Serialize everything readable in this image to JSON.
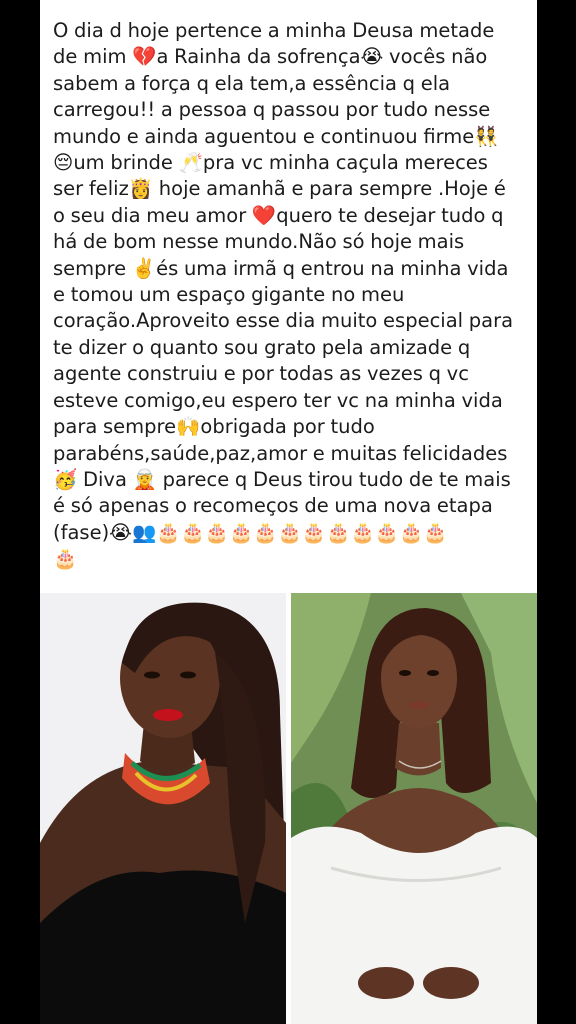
{
  "post": {
    "text": "O dia d hoje pertence a minha Deusa metade\nde mim 💔a Rainha da sofrença😭 vocês não\nsabem a força q ela tem,a essência q ela\ncarregou!! a pessoa q passou por tudo nesse\nmundo e ainda aguentou e continuou firme👯\n😔um brinde 🥂pra vc minha caçula mereces\nser feliz👸 hoje amanhã e para sempre .Hoje é\no seu dia meu amor ❤️quero te desejar tudo q\nhá de bom nesse mundo.Não só hoje mais\nsempre ✌️és uma irmã q entrou na minha vida\ne tomou um espaço gigante no meu\ncoração.Aproveito esse dia muito especial para\nte dizer o quanto sou grato pela amizade q\nagente construiu e por todas as vezes q vc\nesteve comigo,eu espero ter vc na minha vida\npara sempre🙌obrigada por tudo\nparabéns,saúde,paz,amor e muitas felicidades\n🥳 Diva 🧝 parece q Deus tirou tudo de te mais\né só apenas o recomeços de uma nova etapa\n(fase)😭👥🎂🎂🎂🎂🎂🎂🎂🎂🎂🎂🎂🎂\n🎂"
  },
  "photos": [
    {
      "name": "photo-left",
      "subject": "woman-red-lips-black-top",
      "background": "#f1f1f3"
    },
    {
      "name": "photo-right",
      "subject": "woman-white-offshoulder-dress",
      "background": "#6f8f55"
    }
  ],
  "colors": {
    "page_bg": "#000000",
    "card_bg": "#ffffff",
    "text": "#1c1c1c"
  }
}
